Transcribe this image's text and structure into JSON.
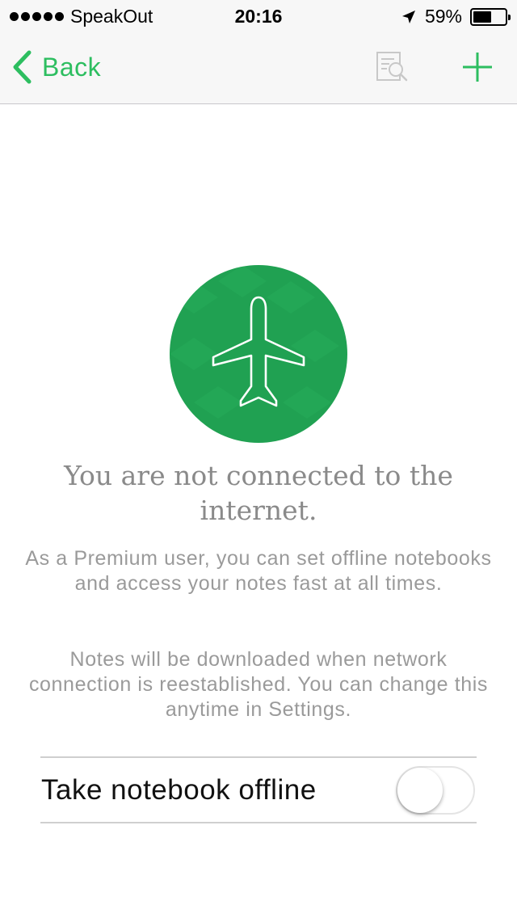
{
  "status_bar": {
    "carrier": "SpeakOut",
    "time": "20:16",
    "battery_percent": "59%",
    "battery_level": 0.59,
    "icons": [
      "signal-dots-icon",
      "location-arrow-icon",
      "battery-icon"
    ]
  },
  "nav": {
    "back_label": "Back",
    "icons": [
      "chevron-left-icon",
      "search-note-icon",
      "plus-icon"
    ]
  },
  "offline": {
    "headline": "You are not connected to the internet.",
    "premium_text": "As a Premium user, you can set offline notebooks and access your notes fast at all times.",
    "download_text": "Notes will be downloaded when network connection is reestablished. You can change this anytime in Settings.",
    "hero_icon": "airplane-icon"
  },
  "toggle": {
    "label": "Take notebook offline",
    "on": false
  },
  "colors": {
    "accent": "#2dbe60",
    "circle": "#20a152",
    "text_gray": "#8a8a8a"
  }
}
